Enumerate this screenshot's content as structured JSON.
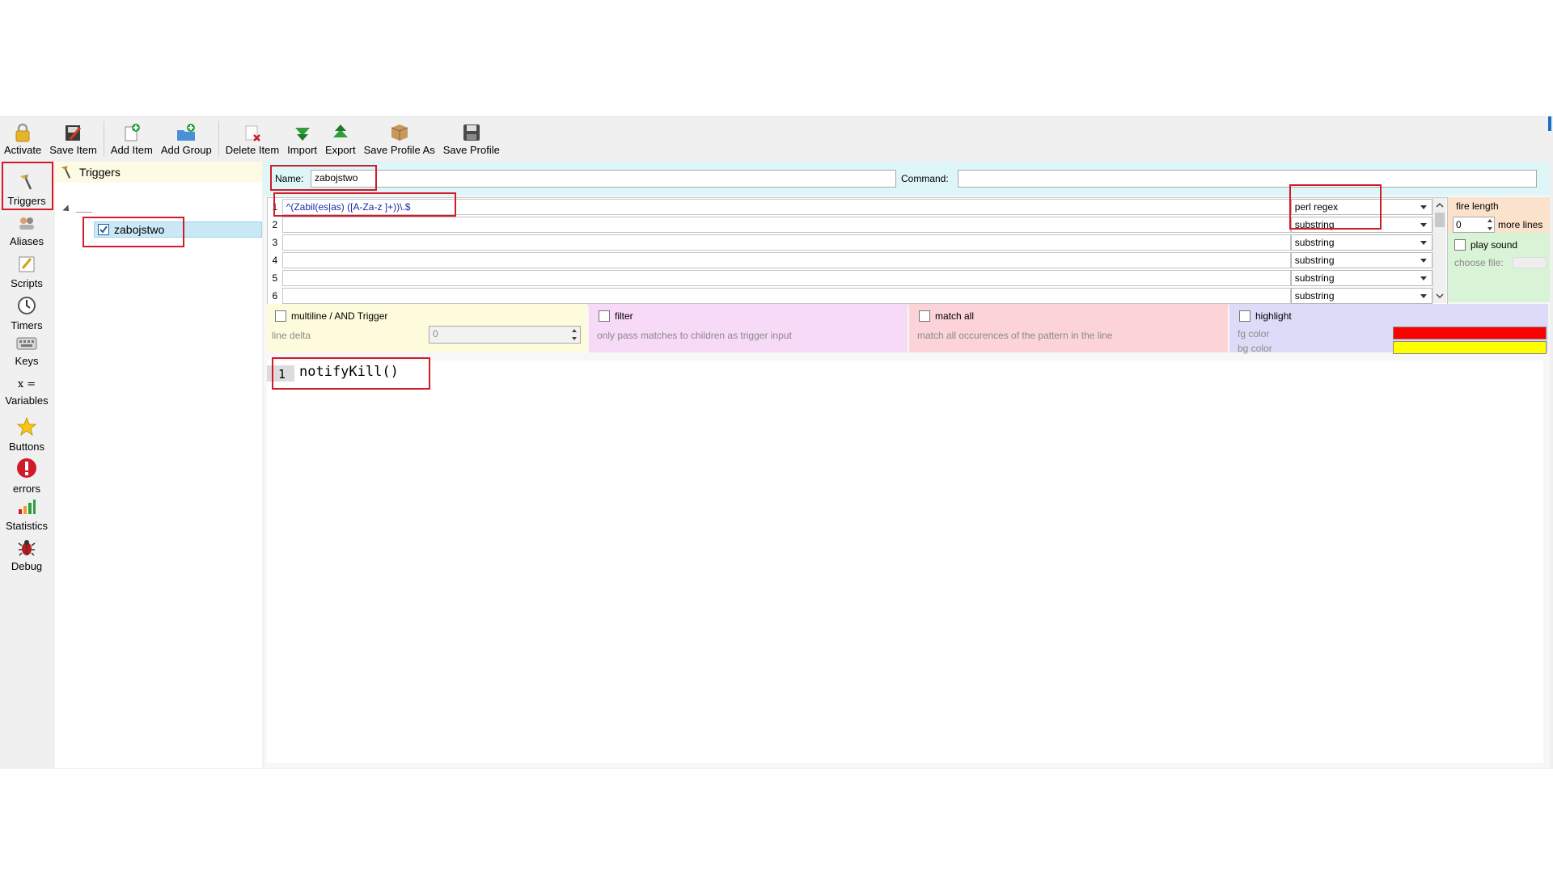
{
  "toolbar": {
    "activate": "Activate",
    "save_item": "Save Item",
    "add_item": "Add Item",
    "add_group": "Add Group",
    "delete_item": "Delete Item",
    "import": "Import",
    "export": "Export",
    "save_profile_as": "Save Profile As",
    "save_profile": "Save Profile"
  },
  "sidebar": {
    "items": [
      {
        "label": "Triggers",
        "icon": "triggers-icon"
      },
      {
        "label": "Aliases",
        "icon": "aliases-icon"
      },
      {
        "label": "Scripts",
        "icon": "scripts-icon"
      },
      {
        "label": "Timers",
        "icon": "timers-icon"
      },
      {
        "label": "Keys",
        "icon": "keys-icon"
      },
      {
        "label": "Variables",
        "icon": "variables-icon"
      },
      {
        "label": "Buttons",
        "icon": "buttons-icon"
      },
      {
        "label": "errors",
        "icon": "errors-icon"
      },
      {
        "label": "Statistics",
        "icon": "statistics-icon"
      },
      {
        "label": "Debug",
        "icon": "debug-icon"
      }
    ]
  },
  "tree": {
    "header": "Triggers",
    "node": "zabojstwo"
  },
  "editor": {
    "name_label": "Name:",
    "name_value": "zabojstwo",
    "command_label": "Command:",
    "command_value": "",
    "patterns": [
      {
        "num": "1",
        "value": "^(Zabil(es|as) ([A-Za-z ]+))\\.$",
        "type": "perl regex"
      },
      {
        "num": "2",
        "value": "",
        "type": "substring"
      },
      {
        "num": "3",
        "value": "",
        "type": "substring"
      },
      {
        "num": "4",
        "value": "",
        "type": "substring"
      },
      {
        "num": "5",
        "value": "",
        "type": "substring"
      },
      {
        "num": "6",
        "value": "",
        "type": "substring"
      }
    ],
    "fire_length_label": "fire length",
    "fire_length_value": "0",
    "more_lines_label": "more lines",
    "play_sound_label": "play sound",
    "choose_file_label": "choose file:",
    "multiline_label": "multiline / AND Trigger",
    "line_delta_label": "line delta",
    "line_delta_value": "0",
    "filter_label": "filter",
    "filter_desc": "only pass matches to children as trigger input",
    "match_all_label": "match all",
    "match_all_desc": "match all occurences of the pattern in the line",
    "highlight_label": "highlight",
    "fg_color_label": "fg color",
    "bg_color_label": "bg color",
    "fg_color": "#ff0000",
    "bg_color": "#ffff00",
    "code_line_number": "1",
    "code": "notifyKill()"
  }
}
